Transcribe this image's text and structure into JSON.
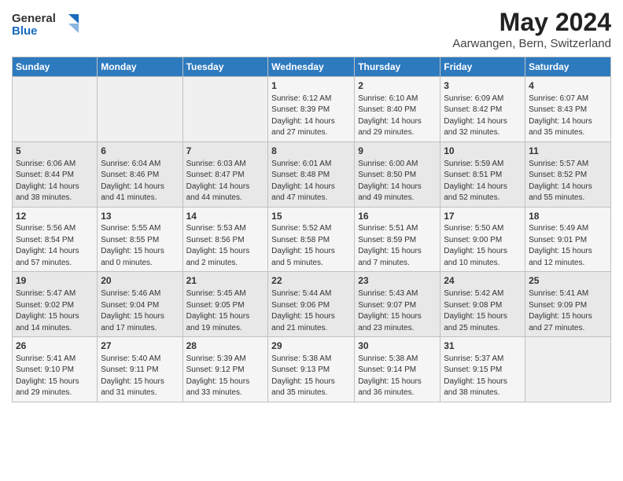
{
  "header": {
    "title": "May 2024",
    "subtitle": "Aarwangen, Bern, Switzerland"
  },
  "calendar": {
    "headers": [
      "Sunday",
      "Monday",
      "Tuesday",
      "Wednesday",
      "Thursday",
      "Friday",
      "Saturday"
    ],
    "weeks": [
      [
        {
          "day": "",
          "info": ""
        },
        {
          "day": "",
          "info": ""
        },
        {
          "day": "",
          "info": ""
        },
        {
          "day": "1",
          "info": "Sunrise: 6:12 AM\nSunset: 8:39 PM\nDaylight: 14 hours\nand 27 minutes."
        },
        {
          "day": "2",
          "info": "Sunrise: 6:10 AM\nSunset: 8:40 PM\nDaylight: 14 hours\nand 29 minutes."
        },
        {
          "day": "3",
          "info": "Sunrise: 6:09 AM\nSunset: 8:42 PM\nDaylight: 14 hours\nand 32 minutes."
        },
        {
          "day": "4",
          "info": "Sunrise: 6:07 AM\nSunset: 8:43 PM\nDaylight: 14 hours\nand 35 minutes."
        }
      ],
      [
        {
          "day": "5",
          "info": "Sunrise: 6:06 AM\nSunset: 8:44 PM\nDaylight: 14 hours\nand 38 minutes."
        },
        {
          "day": "6",
          "info": "Sunrise: 6:04 AM\nSunset: 8:46 PM\nDaylight: 14 hours\nand 41 minutes."
        },
        {
          "day": "7",
          "info": "Sunrise: 6:03 AM\nSunset: 8:47 PM\nDaylight: 14 hours\nand 44 minutes."
        },
        {
          "day": "8",
          "info": "Sunrise: 6:01 AM\nSunset: 8:48 PM\nDaylight: 14 hours\nand 47 minutes."
        },
        {
          "day": "9",
          "info": "Sunrise: 6:00 AM\nSunset: 8:50 PM\nDaylight: 14 hours\nand 49 minutes."
        },
        {
          "day": "10",
          "info": "Sunrise: 5:59 AM\nSunset: 8:51 PM\nDaylight: 14 hours\nand 52 minutes."
        },
        {
          "day": "11",
          "info": "Sunrise: 5:57 AM\nSunset: 8:52 PM\nDaylight: 14 hours\nand 55 minutes."
        }
      ],
      [
        {
          "day": "12",
          "info": "Sunrise: 5:56 AM\nSunset: 8:54 PM\nDaylight: 14 hours\nand 57 minutes."
        },
        {
          "day": "13",
          "info": "Sunrise: 5:55 AM\nSunset: 8:55 PM\nDaylight: 15 hours\nand 0 minutes."
        },
        {
          "day": "14",
          "info": "Sunrise: 5:53 AM\nSunset: 8:56 PM\nDaylight: 15 hours\nand 2 minutes."
        },
        {
          "day": "15",
          "info": "Sunrise: 5:52 AM\nSunset: 8:58 PM\nDaylight: 15 hours\nand 5 minutes."
        },
        {
          "day": "16",
          "info": "Sunrise: 5:51 AM\nSunset: 8:59 PM\nDaylight: 15 hours\nand 7 minutes."
        },
        {
          "day": "17",
          "info": "Sunrise: 5:50 AM\nSunset: 9:00 PM\nDaylight: 15 hours\nand 10 minutes."
        },
        {
          "day": "18",
          "info": "Sunrise: 5:49 AM\nSunset: 9:01 PM\nDaylight: 15 hours\nand 12 minutes."
        }
      ],
      [
        {
          "day": "19",
          "info": "Sunrise: 5:47 AM\nSunset: 9:02 PM\nDaylight: 15 hours\nand 14 minutes."
        },
        {
          "day": "20",
          "info": "Sunrise: 5:46 AM\nSunset: 9:04 PM\nDaylight: 15 hours\nand 17 minutes."
        },
        {
          "day": "21",
          "info": "Sunrise: 5:45 AM\nSunset: 9:05 PM\nDaylight: 15 hours\nand 19 minutes."
        },
        {
          "day": "22",
          "info": "Sunrise: 5:44 AM\nSunset: 9:06 PM\nDaylight: 15 hours\nand 21 minutes."
        },
        {
          "day": "23",
          "info": "Sunrise: 5:43 AM\nSunset: 9:07 PM\nDaylight: 15 hours\nand 23 minutes."
        },
        {
          "day": "24",
          "info": "Sunrise: 5:42 AM\nSunset: 9:08 PM\nDaylight: 15 hours\nand 25 minutes."
        },
        {
          "day": "25",
          "info": "Sunrise: 5:41 AM\nSunset: 9:09 PM\nDaylight: 15 hours\nand 27 minutes."
        }
      ],
      [
        {
          "day": "26",
          "info": "Sunrise: 5:41 AM\nSunset: 9:10 PM\nDaylight: 15 hours\nand 29 minutes."
        },
        {
          "day": "27",
          "info": "Sunrise: 5:40 AM\nSunset: 9:11 PM\nDaylight: 15 hours\nand 31 minutes."
        },
        {
          "day": "28",
          "info": "Sunrise: 5:39 AM\nSunset: 9:12 PM\nDaylight: 15 hours\nand 33 minutes."
        },
        {
          "day": "29",
          "info": "Sunrise: 5:38 AM\nSunset: 9:13 PM\nDaylight: 15 hours\nand 35 minutes."
        },
        {
          "day": "30",
          "info": "Sunrise: 5:38 AM\nSunset: 9:14 PM\nDaylight: 15 hours\nand 36 minutes."
        },
        {
          "day": "31",
          "info": "Sunrise: 5:37 AM\nSunset: 9:15 PM\nDaylight: 15 hours\nand 38 minutes."
        },
        {
          "day": "",
          "info": ""
        }
      ]
    ]
  }
}
